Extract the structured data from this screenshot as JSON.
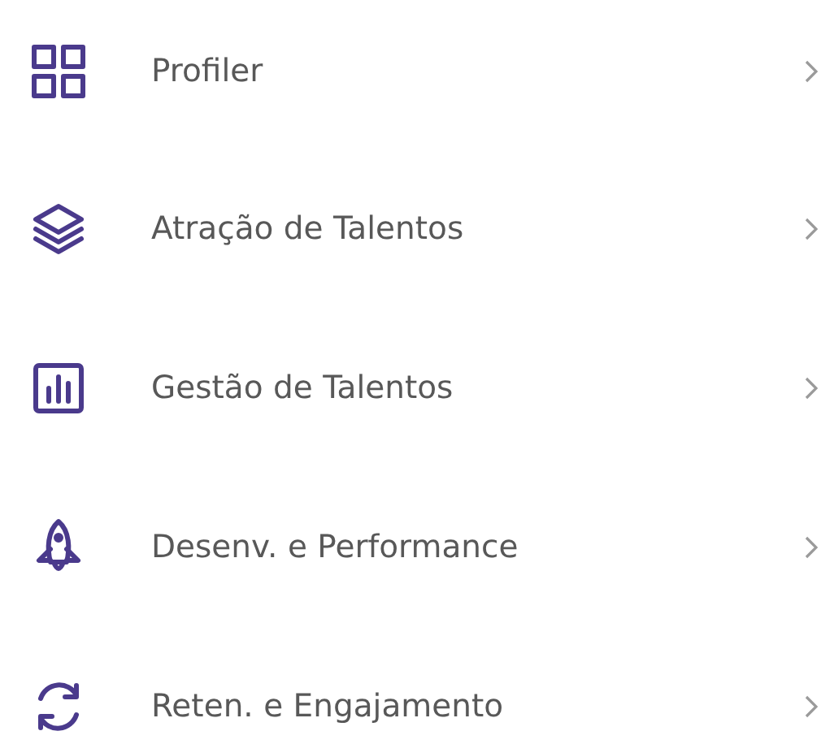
{
  "menu": [
    {
      "kind": "grid",
      "label": "Profiler"
    },
    {
      "kind": "layers",
      "label": "Atração de Talentos"
    },
    {
      "kind": "chart",
      "label": "Gestão de Talentos"
    },
    {
      "kind": "rocket",
      "label": "Desenv. e Performance"
    },
    {
      "kind": "sync",
      "label": "Reten. e Engajamento"
    }
  ]
}
